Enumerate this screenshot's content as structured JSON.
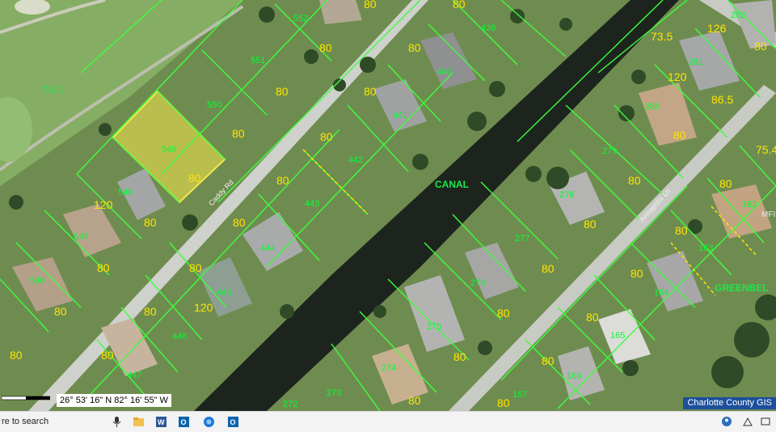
{
  "map": {
    "water_label": "CANAL",
    "zone_label": "TG-1",
    "greenbelt_label": "GREENBEL",
    "streets": [
      "Caddy Rd",
      "Annapolis Ln"
    ],
    "parcels": [
      "552",
      "551",
      "550",
      "549",
      "548",
      "547",
      "546",
      "445",
      "446",
      "447",
      "443",
      "444",
      "442",
      "441",
      "440",
      "439",
      "282",
      "281",
      "280",
      "279",
      "278",
      "277",
      "276",
      "275",
      "274",
      "273",
      "272",
      "167",
      "166",
      "165",
      "164",
      "163",
      "162"
    ],
    "dimensions": [
      "80",
      "120",
      "73.5",
      "86.5",
      "75.4",
      "126",
      "120"
    ],
    "partial_label": "MFI",
    "coordinates": "26° 53' 16\" N 82° 16' 55\" W",
    "credit": "Charlotte County GIS",
    "colors": {
      "parcel_line": "#3cff3c",
      "dimension": "#ffe400",
      "parcel_number": "#00ff33",
      "highlight": "#f5e84a"
    }
  },
  "taskbar": {
    "search_text": "re to search",
    "icons": [
      "microphone-icon",
      "file-explorer-icon",
      "word-icon",
      "outlook-icon",
      "browser-icon",
      "outlook-icon"
    ]
  }
}
